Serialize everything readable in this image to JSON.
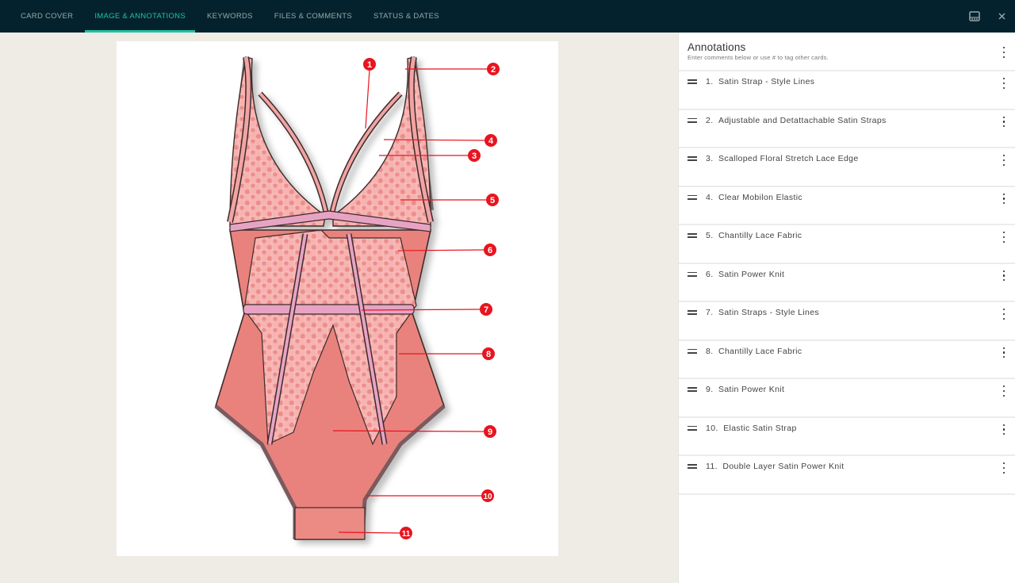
{
  "tabs": [
    {
      "label": "CARD COVER",
      "active": false
    },
    {
      "label": "IMAGE & ANNOTATIONS",
      "active": true
    },
    {
      "label": "KEYWORDS",
      "active": false
    },
    {
      "label": "FILES & COMMENTS",
      "active": false
    },
    {
      "label": "STATUS & DATES",
      "active": false
    }
  ],
  "top_icons": {
    "panel_toggle": "panel-layout-icon",
    "close": "close-icon",
    "close_glyph": "×"
  },
  "colors": {
    "topbar_bg": "#04222d",
    "accent": "#1fc2a0",
    "canvas_bg": "#efebe5",
    "marker_red": "#e8141f",
    "garment_salmon": "#e9827c",
    "lace_pink": "#f4a6a4"
  },
  "image": {
    "markers": [
      "1",
      "2",
      "3",
      "4",
      "5",
      "6",
      "7",
      "8",
      "9",
      "10",
      "11"
    ]
  },
  "annotations_panel": {
    "title": "Annotations",
    "subtitle": "Enter comments below or use # to tag other cards.",
    "items": [
      {
        "number": "1.",
        "label": "Satin Strap - Style Lines"
      },
      {
        "number": "2.",
        "label": "Adjustable and Detattachable Satin Straps"
      },
      {
        "number": "3.",
        "label": "Scalloped Floral Stretch Lace Edge"
      },
      {
        "number": "4.",
        "label": "Clear Mobilon Elastic"
      },
      {
        "number": "5.",
        "label": "Chantilly Lace Fabric"
      },
      {
        "number": "6.",
        "label": "Satin Power Knit"
      },
      {
        "number": "7.",
        "label": "Satin Straps - Style Lines"
      },
      {
        "number": "8.",
        "label": "Chantilly Lace Fabric"
      },
      {
        "number": "9.",
        "label": "Satin Power Knit"
      },
      {
        "number": "10.",
        "label": "Elastic Satin Strap"
      },
      {
        "number": "11.",
        "label": "Double Layer Satin Power Knit"
      }
    ]
  }
}
